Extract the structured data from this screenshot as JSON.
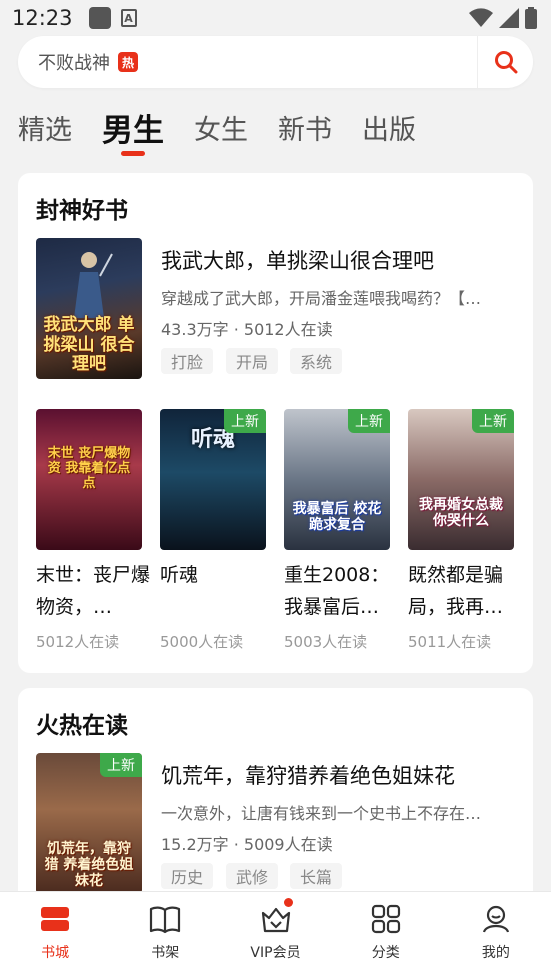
{
  "status": {
    "time": "12:23"
  },
  "search": {
    "text": "不败战神",
    "badge": "热"
  },
  "tabs": [
    {
      "label": "精选"
    },
    {
      "label": "男生"
    },
    {
      "label": "女生"
    },
    {
      "label": "新书"
    },
    {
      "label": "出版"
    }
  ],
  "section1": {
    "title": "封神好书",
    "featured": {
      "cover_text": "我武大郎 单挑梁山 很合理吧",
      "title": "我武大郎，单挑梁山很合理吧",
      "desc": "穿越成了武大郎，开局潘金莲喂我喝药？【…",
      "meta": "43.3万字 · 5012人在读",
      "tags": [
        "打脸",
        "开局",
        "系统"
      ]
    },
    "grid": [
      {
        "title": "末世：丧尸爆物资，…",
        "readers": "5012人在读",
        "cover_text": "末世 丧尸爆物资 我靠着亿点点",
        "new": ""
      },
      {
        "title": "听魂",
        "readers": "5000人在读",
        "cover_text": "听魂",
        "new": "上新"
      },
      {
        "title": "重生2008：我暴富后…",
        "readers": "5003人在读",
        "cover_text": "我暴富后 校花跪求复合",
        "new": "上新"
      },
      {
        "title": "既然都是骗局，我再…",
        "readers": "5011人在读",
        "cover_text": "我再婚女总裁 你哭什么",
        "new": "上新"
      }
    ]
  },
  "section2": {
    "title": "火热在读",
    "featured": {
      "cover_text": "饥荒年，靠狩猎 养着绝色姐妹花",
      "new": "上新",
      "title": "饥荒年，靠狩猎养着绝色姐妹花",
      "desc": "一次意外，让唐有钱来到一个史书上不存在…",
      "meta": "15.2万字 · 5009人在读",
      "tags": [
        "历史",
        "武修",
        "长篇"
      ]
    }
  },
  "bottom_nav": [
    {
      "label": "书城",
      "icon": "bookstore-icon"
    },
    {
      "label": "书架",
      "icon": "bookshelf-icon"
    },
    {
      "label": "VIP会员",
      "icon": "vip-crown-icon"
    },
    {
      "label": "分类",
      "icon": "category-grid-icon"
    },
    {
      "label": "我的",
      "icon": "profile-icon"
    }
  ],
  "colors": {
    "accent": "#e8311a",
    "new_badge": "#3ea94a"
  }
}
